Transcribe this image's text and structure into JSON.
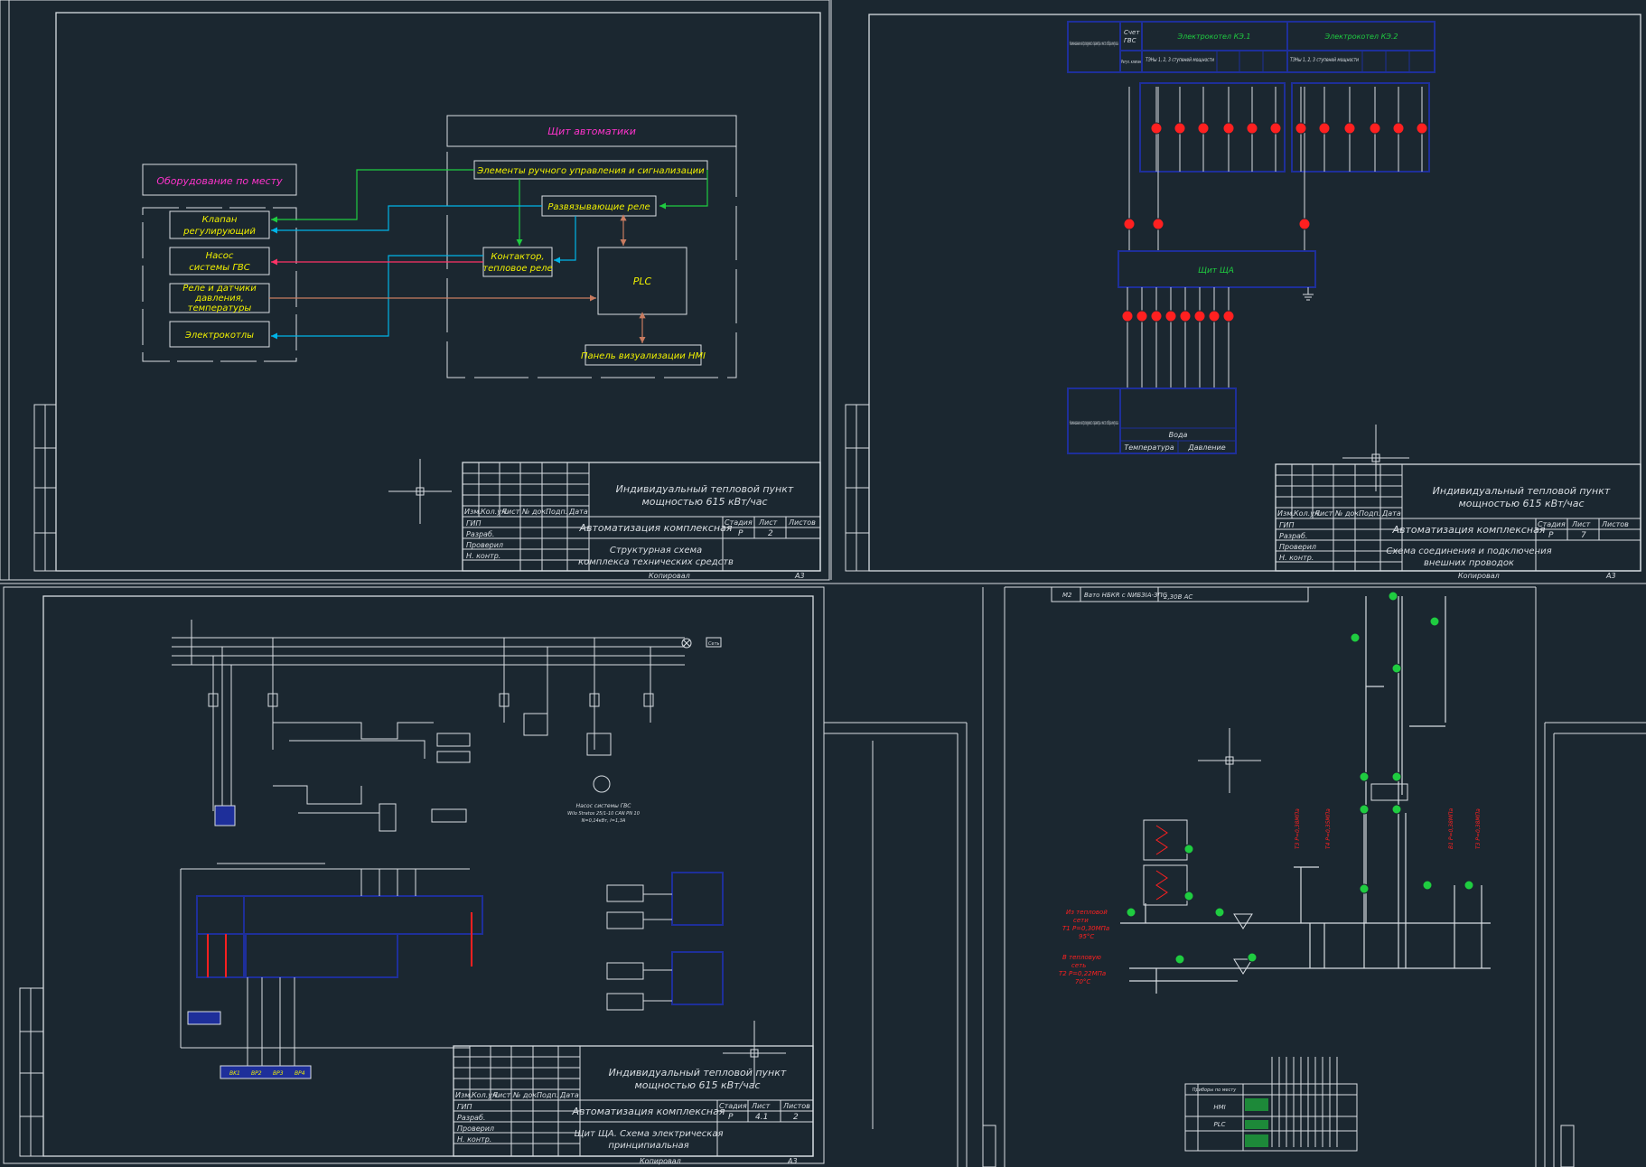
{
  "colors": {
    "background": "#1b2730",
    "frame": "#d8dde2",
    "yellow": "#f0f000",
    "magenta": "#ff33cc",
    "blue": "#1e2f9a",
    "cyan": "#00b4e8",
    "red": "#ff2020",
    "green": "#1fcc40",
    "brown": "#c87b60"
  },
  "sheet1": {
    "title_line1": "Индивидуальный тепловой пункт",
    "title_line2": "мощностью 615 кВт/час",
    "project": "Автоматизация комплексная",
    "drawing": "Структурная схема комплекса технических средств",
    "drawing_l1": "Структурная схема",
    "drawing_l2": "комплекса технических средств",
    "stage": "Р",
    "sheet": "2",
    "copy": "Копировал",
    "format": "А3",
    "blocks": {
      "local_equipment": "Оборудование по месту",
      "valve_l1": "Клапан",
      "valve_l2": "регулирующий",
      "pump_l1": "Насос",
      "pump_l2": "системы ГВС",
      "sensors_l1": "Реле и датчики",
      "sensors_l2": "давления,",
      "sensors_l3": "температуры",
      "boilers": "Электрокотлы",
      "panel": "Щит автоматики",
      "manual": "Элементы ручного управления и сигнализации",
      "relays": "Развязывающие реле",
      "contactor_l1": "Контактор,",
      "contactor_l2": "тепловое реле",
      "plc": "PLC",
      "hmi": "Панель визуализации HMI"
    }
  },
  "sheet7": {
    "title_line1": "Индивидуальный тепловой пункт",
    "title_line2": "мощностью 615 кВт/час",
    "project": "Автоматизация комплексная",
    "drawing_l1": "Схема соединения и подключения",
    "drawing_l2": "внешних проводок",
    "stage": "Р",
    "sheet": "7",
    "copy": "Копировал",
    "format": "А3",
    "param_header": "Наименование контролируемого параметра и место отбора импульса",
    "dhw_l1": "Счет",
    "dhw_l2": "ГВС",
    "reg_valve": "Регул. клапан",
    "boiler1": "Электрокотел КЭ.1",
    "boiler2": "Электрокотел КЭ.2",
    "ten_stages": "ТЭНы 1, 2, 3 ступеней мощности",
    "panel": "Щит ЩА",
    "temperature": "Температура",
    "water": "Вода",
    "pressure": "Давление"
  },
  "sheet41": {
    "title_line1": "Индивидуальный тепловой пункт",
    "title_line2": "мощностью 615 кВт/час",
    "project": "Автоматизация комплексная",
    "drawing_l1": "Щит ЩА. Схема электрическая",
    "drawing_l2": "принципиальная",
    "stage": "Р",
    "sheet": "4.1",
    "sheets": "2",
    "copy": "Копировал",
    "format": "А3",
    "pump_caption": "Насос системы ГВС",
    "pump_model": "Wilo Stratos 25/1-10 CAN PN 10",
    "pump_params": "N=0,14кВт, I=1,3А",
    "sensors": [
      "BK1",
      "BP2",
      "BP3",
      "BP4"
    ],
    "rail_label": "Сеть"
  },
  "sheet_mnem": {
    "spec_row_code": "М2",
    "spec_row_text": "Вато HБКR с NИБЗIА-ЗПС",
    "spec_row_note": "2,30В АС",
    "heat_in_l1": "Из тепловой",
    "heat_in_l2": "сети",
    "heat_in_l3": "Т1  Р=0,30МПа",
    "heat_in_l4": "95°С",
    "heat_out_l1": "В тепловую",
    "heat_out_l2": "сеть",
    "heat_out_l3": "Т2  Р=0,22МПа",
    "heat_out_l4": "70°С",
    "table_title": "Приборы по месту",
    "table_rows": [
      "HMI",
      "PLC"
    ]
  },
  "title_block": {
    "cols": [
      "Изм.",
      "Кол.уч.",
      "Лист",
      "№ док.",
      "Подп.",
      "Дата"
    ],
    "rows": [
      "ГИП",
      "Разраб.",
      "Проверил",
      "Н. контр."
    ],
    "stage_h": "Стадия",
    "sheet_h": "Лист",
    "sheets_h": "Листов"
  }
}
